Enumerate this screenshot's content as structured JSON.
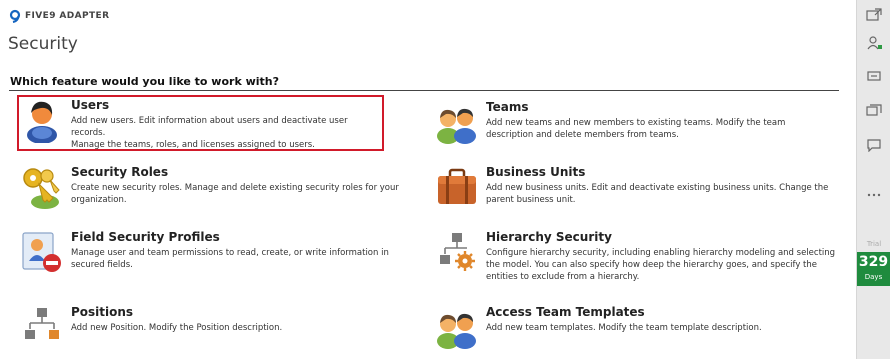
{
  "app": {
    "name": "FIVE9 ADAPTER"
  },
  "page": {
    "title": "Security",
    "question": "Which feature would you like to work with?"
  },
  "features": [
    {
      "title": "Users",
      "desc1": "Add new users. Edit information about users and deactivate user records.",
      "desc2": "Manage the teams, roles, and licenses assigned to users.",
      "desc3": "",
      "icon": "user-icon",
      "selected": true
    },
    {
      "title": "Teams",
      "desc1": "Add new teams and new members to existing teams. Modify the team",
      "desc2": "description and delete members from teams.",
      "desc3": "",
      "icon": "team-icon"
    },
    {
      "title": "Security Roles",
      "desc1": "Create new security roles. Manage and delete existing security roles for your",
      "desc2": "organization.",
      "desc3": "",
      "icon": "keys-icon"
    },
    {
      "title": "Business Units",
      "desc1": "Add new business units. Edit and deactivate existing business units. Change the",
      "desc2": "parent business unit.",
      "desc3": "",
      "icon": "briefcase-icon"
    },
    {
      "title": "Field Security Profiles",
      "desc1": "Manage user and team permissions to read, create, or write information in",
      "desc2": "secured fields.",
      "desc3": "",
      "icon": "profile-lock-icon"
    },
    {
      "title": "Hierarchy Security",
      "desc1": "Configure hierarchy security, including enabling hierarchy modeling and selecting",
      "desc2": "the model. You can also specify how deep the hierarchy goes, and specify the",
      "desc3": "entities to exclude from a hierarchy.",
      "icon": "hierarchy-gear-icon"
    },
    {
      "title": "Positions",
      "desc1": "Add new Position. Modify the Position description.",
      "desc2": "",
      "desc3": "",
      "icon": "org-chart-icon"
    },
    {
      "title": "Access Team Templates",
      "desc1": "Add new team templates. Modify the team template description.",
      "desc2": "",
      "desc3": "",
      "icon": "team-icon"
    }
  ],
  "rail": {
    "trial_label": "Trial",
    "trial_days": "329",
    "trial_unit": "Days"
  },
  "colors": {
    "selection": "#d11a2a",
    "trial": "#1f8b3e"
  }
}
